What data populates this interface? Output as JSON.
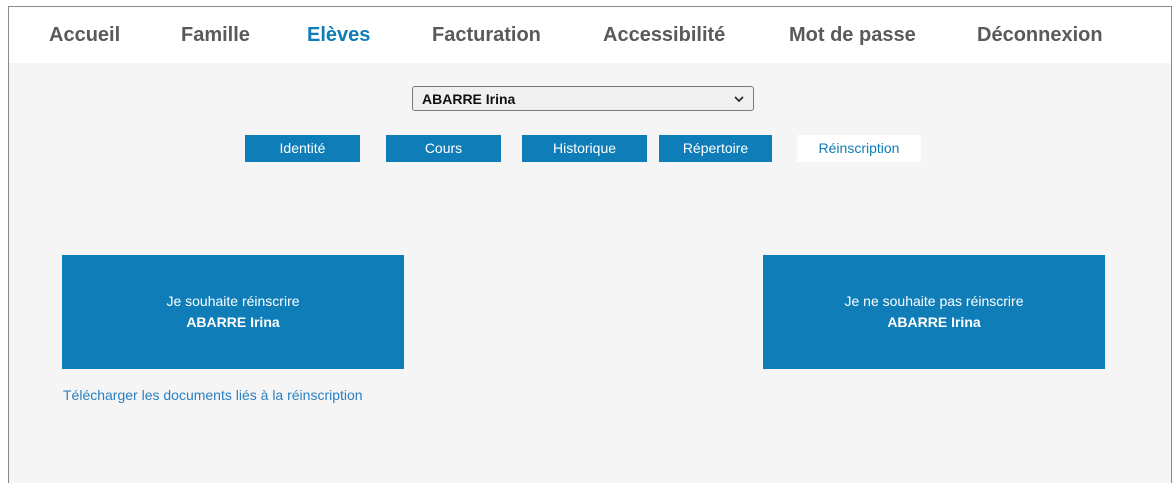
{
  "nav": {
    "items": [
      {
        "label": "Accueil"
      },
      {
        "label": "Famille"
      },
      {
        "label": "Elèves"
      },
      {
        "label": "Facturation"
      },
      {
        "label": "Accessibilité"
      },
      {
        "label": "Mot de passe"
      },
      {
        "label": "Déconnexion"
      }
    ],
    "active": "Elèves"
  },
  "student_select": {
    "value": "ABARRE Irina"
  },
  "tabs": [
    {
      "label": "Identité"
    },
    {
      "label": "Cours"
    },
    {
      "label": "Historique"
    },
    {
      "label": "Répertoire"
    },
    {
      "label": "Réinscription"
    }
  ],
  "active_tab": "Réinscription",
  "reenroll_yes": {
    "line1": "Je souhaite réinscrire",
    "line2": "ABARRE Irina"
  },
  "reenroll_no": {
    "line1": "Je ne souhaite pas réinscrire",
    "line2": "ABARRE Irina"
  },
  "documents_link": "Télécharger les documents liés à la réinscription",
  "colors": {
    "accent": "#0f7db8",
    "nav_text": "#5a5a5a",
    "background": "#f5f5f5",
    "link": "#2b7fc0"
  }
}
